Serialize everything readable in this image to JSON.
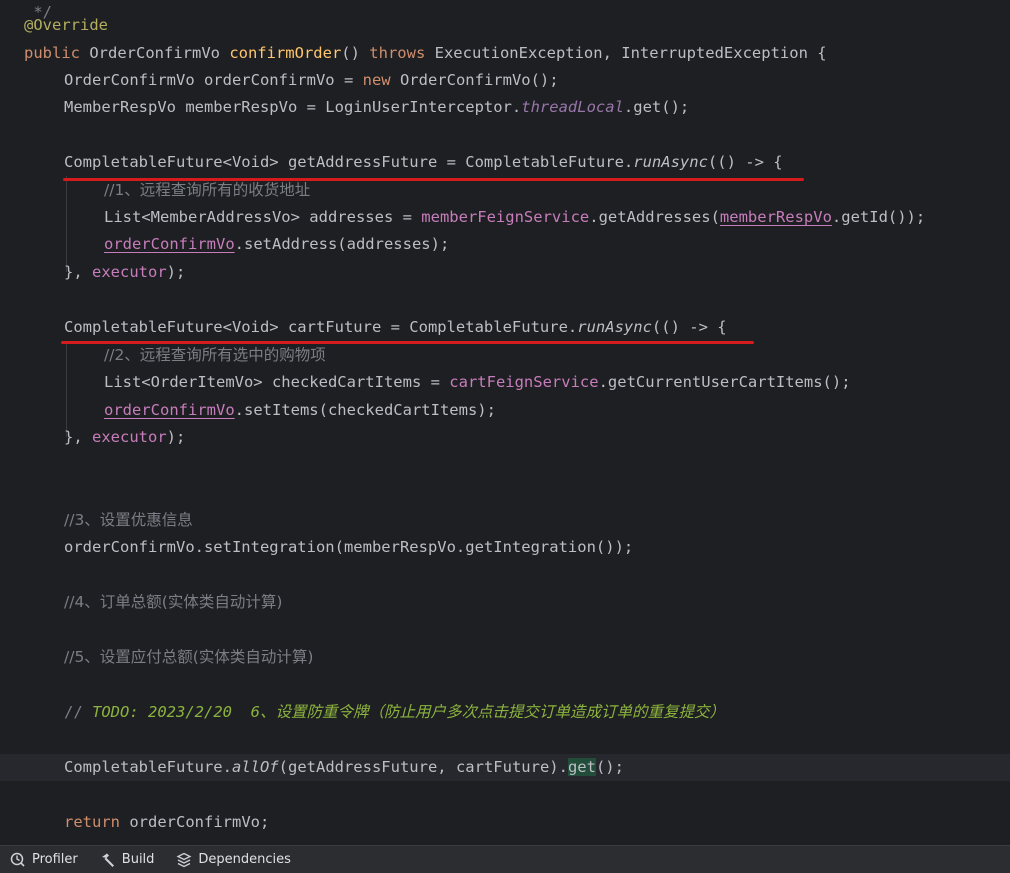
{
  "code": {
    "top_fragment": " */",
    "l_override": "@Override",
    "l_sig": {
      "kw_public": "public",
      "ret_type": " OrderConfirmVo ",
      "method": "confirmOrder",
      "paren": "() ",
      "kw_throws": "throws",
      "exceptions": " ExecutionException, InterruptedException {"
    },
    "l_new": {
      "a": "OrderConfirmVo orderConfirmVo = ",
      "kw_new": "new",
      "b": " OrderConfirmVo();"
    },
    "l_member": {
      "a": "MemberRespVo memberRespVo = LoginUserInterceptor.",
      "field": "threadLocal",
      "b": ".get();"
    },
    "l_addr_future": {
      "a": "CompletableFuture<Void> getAddressFuture = CompletableFuture.",
      "method": "runAsync",
      "b": "(() -> {"
    },
    "l_addr_comment": "//1、远程查询所有的收货地址",
    "l_addr_list": {
      "a": "List<MemberAddressVo> addresses = ",
      "field": "memberFeignService",
      "b": ".getAddresses(",
      "var": "memberRespVo",
      "c": ".getId());"
    },
    "l_addr_set": {
      "var": "orderConfirmVo",
      "b": ".setAddress(addresses);"
    },
    "l_addr_close": {
      "a": "}, ",
      "field": "executor",
      "b": ");"
    },
    "l_cart_future": {
      "a": "CompletableFuture<Void> cartFuture = CompletableFuture.",
      "method": "runAsync",
      "b": "(() -> {"
    },
    "l_cart_comment": "//2、远程查询所有选中的购物项",
    "l_cart_list": {
      "a": "List<OrderItemVo> checkedCartItems = ",
      "field": "cartFeignService",
      "b": ".getCurrentUserCartItems();"
    },
    "l_cart_set": {
      "var": "orderConfirmVo",
      "b": ".setItems(checkedCartItems);"
    },
    "l_cart_close": {
      "a": "}, ",
      "field": "executor",
      "b": ");"
    },
    "l_c3": "//3、设置优惠信息",
    "l_integration": "orderConfirmVo.setIntegration(memberRespVo.getIntegration());",
    "l_c4": "//4、订单总额(实体类自动计算)",
    "l_c5": "//5、设置应付总额(实体类自动计算)",
    "l_todo": {
      "prefix": "// ",
      "tag": "TODO: 2023/2/20  6、",
      "text": "设置防重令牌（防止用户多次点击提交订单造成订单的重复提交）"
    },
    "l_allof": {
      "a": "CompletableFuture.",
      "method": "allOf",
      "b": "(getAddressFuture, cartFuture).",
      "get": "get",
      "c": "();"
    },
    "l_return": {
      "kw": "return",
      "b": " orderConfirmVo;"
    }
  },
  "statusbar": {
    "profiler": "Profiler",
    "build": "Build",
    "dependencies": "Dependencies"
  },
  "colors": {
    "background": "#1e1f22",
    "keyword": "#cf8e6d",
    "annotation": "#b3ae60",
    "method": "#56a8f5",
    "comment": "#7a7e85",
    "todo": "#8bb33d",
    "red_mark": "#d51b1b"
  },
  "icons": [
    "profiler-icon",
    "build-hammer-icon",
    "dependencies-icon"
  ]
}
